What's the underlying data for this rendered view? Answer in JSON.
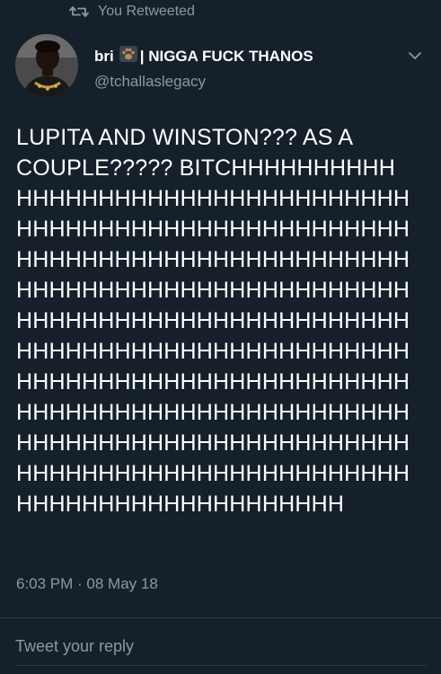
{
  "retweet": {
    "label": "You Retweeted"
  },
  "tweet": {
    "display_name": "bri",
    "name_suffix": "| NIGGA FUCK THANOS",
    "handle": "@tchallaslegacy",
    "text_lines": [
      "LUPITA AND WINSTON??? AS A",
      "COUPLE????? BITCHHHHHHHHHH",
      "HHHHHHHHHHHHHHHHHHHHHHHH",
      "HHHHHHHHHHHHHHHHHHHHHHHH",
      "HHHHHHHHHHHHHHHHHHHHHHHH",
      "HHHHHHHHHHHHHHHHHHHHHHHH",
      "HHHHHHHHHHHHHHHHHHHHHHHH",
      "HHHHHHHHHHHHHHHHHHHHHHHH",
      "HHHHHHHHHHHHHHHHHHHHHHHH",
      "HHHHHHHHHHHHHHHHHHHHHHHH",
      "HHHHHHHHHHHHHHHHHHHHHHHH",
      "HHHHHHHHHHHHHHHHHHHHHHHH",
      "HHHHHHHHHHHHHHHHHHHH"
    ],
    "timestamp": "6:03 PM · 08 May 18"
  },
  "reply": {
    "placeholder": "Tweet your reply"
  },
  "icons": {
    "retweet": "retweet-icon",
    "paw": "paw-print-icon",
    "chevron": "chevron-down-icon"
  },
  "colors": {
    "background": "#15202b",
    "secondary_text": "#8899a6",
    "primary_text": "#ffffff",
    "divider": "#2c3a47"
  }
}
